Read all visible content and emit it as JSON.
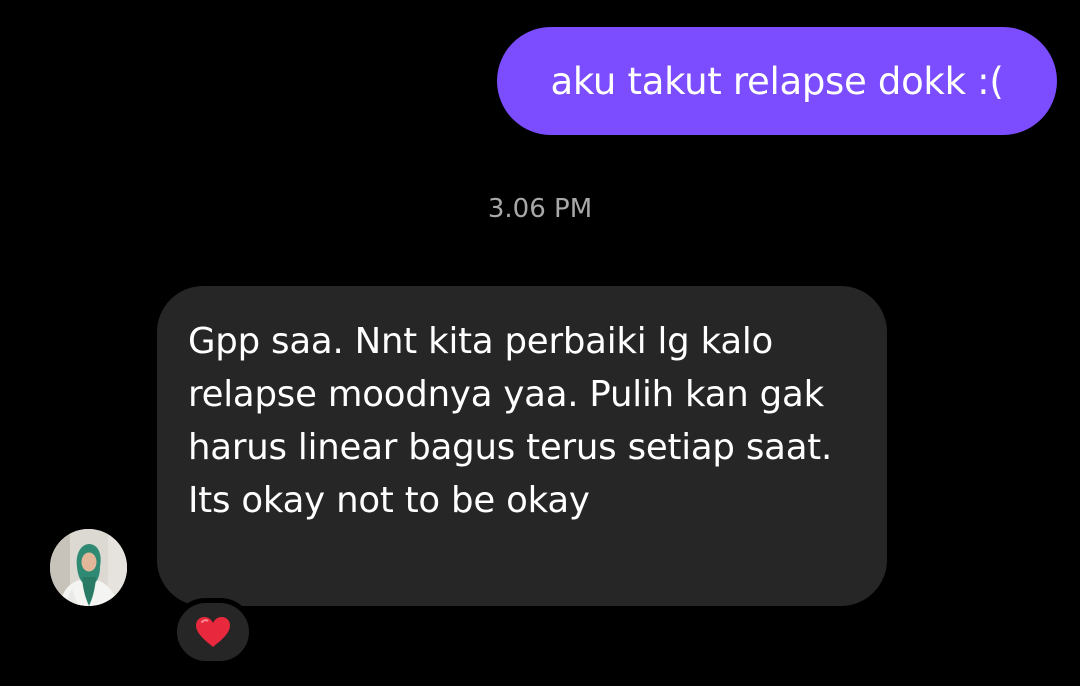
{
  "conversation": {
    "messages": [
      {
        "direction": "outgoing",
        "text": "aku takut relapse dokk :("
      },
      {
        "direction": "incoming",
        "text": "Gpp saa. Nnt kita perbaiki lg kalo relapse moodnya yaa. Pulih kan gak harus linear bagus terus setiap saat. Its okay not to be okay",
        "reaction": "heart-icon"
      }
    ],
    "timestamp": "3.06 PM"
  },
  "colors": {
    "background": "#000000",
    "outgoing_bubble": "#7b4dff",
    "incoming_bubble": "#262626",
    "timestamp_text": "#a8a8a8",
    "reaction_bg": "#262626",
    "heart": "#e8283c"
  }
}
